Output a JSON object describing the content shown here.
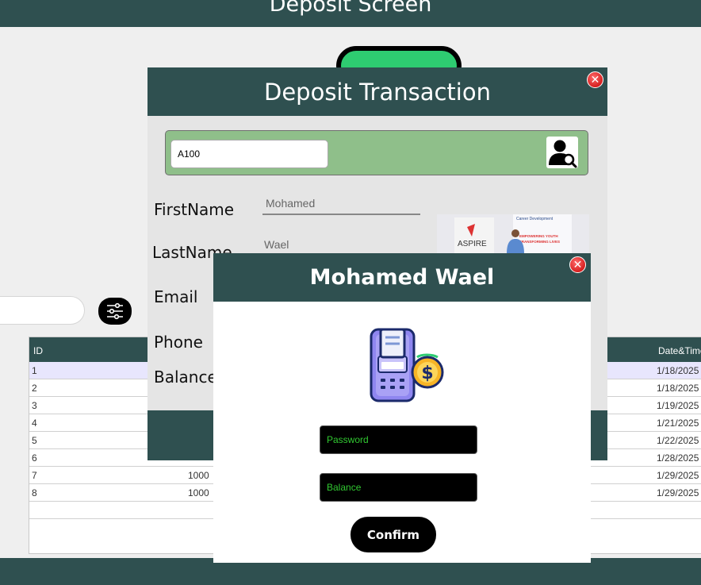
{
  "screen": {
    "title": "Deposit Screen"
  },
  "filter": {
    "icon": "sliders-icon"
  },
  "grid": {
    "columns": {
      "id": "ID",
      "datetime": "Date&Time"
    },
    "rows": [
      {
        "id": "1",
        "amount": "",
        "date": "1/18/2025"
      },
      {
        "id": "2",
        "amount": "",
        "date": "1/18/2025"
      },
      {
        "id": "3",
        "amount": "",
        "date": "1/19/2025"
      },
      {
        "id": "4",
        "amount": "",
        "date": "1/21/2025"
      },
      {
        "id": "5",
        "amount": "",
        "date": "1/22/2025"
      },
      {
        "id": "6",
        "amount": "",
        "date": "1/28/2025"
      },
      {
        "id": "7",
        "amount": "1000",
        "date": "1/29/2025"
      },
      {
        "id": "8",
        "amount": "1000",
        "date": "1/29/2025"
      }
    ]
  },
  "deposit": {
    "title": "Deposit Transaction",
    "account_value": "A100",
    "labels": {
      "first": "FirstName",
      "last": "LastName",
      "email": "Email",
      "phone": "Phone",
      "balance": "Balance"
    },
    "first_value": "Mohamed",
    "last_value": "Wael",
    "photo_text": {
      "brand": "ASPIRE",
      "banner1": "Career Development",
      "banner2": "EMPOWERING YOUTH",
      "banner3": "TRANSFORMING LIVES"
    }
  },
  "dialog": {
    "title": "Mohamed  Wael",
    "password_placeholder": "Password",
    "balance_placeholder": "Balance",
    "confirm_label": "Confirm"
  },
  "colors": {
    "header": "#2f5050",
    "search_strip": "#8fbf8a",
    "pill": "#2ecc71",
    "field_text": "#31c831"
  }
}
